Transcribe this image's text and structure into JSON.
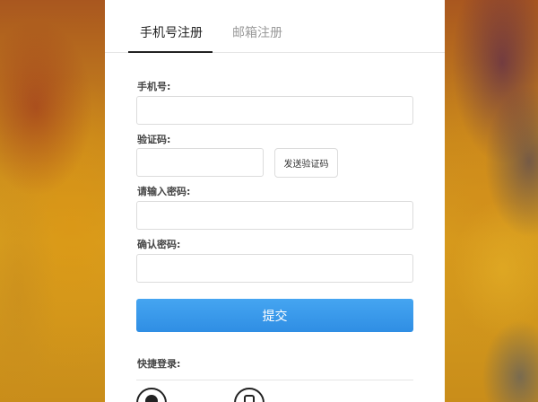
{
  "tabs": [
    {
      "label": "手机号注册"
    },
    {
      "label": "邮箱注册"
    }
  ],
  "form": {
    "phone": {
      "label": "手机号:",
      "value": "",
      "placeholder": ""
    },
    "code": {
      "label": "验证码:",
      "value": "",
      "placeholder": ""
    },
    "send_code_label": "发送验证码",
    "password": {
      "label": "请输入密码:",
      "value": "",
      "placeholder": ""
    },
    "confirm": {
      "label": "确认密码:",
      "value": "",
      "placeholder": ""
    },
    "submit_label": "提交"
  },
  "quick_login": {
    "label": "快捷登录:",
    "icons": [
      "social-login-1-icon",
      "social-login-2-icon"
    ]
  },
  "colors": {
    "submit": "#2f8ee4",
    "active_tab": "#222222",
    "inactive_tab": "#9a9a9a"
  }
}
